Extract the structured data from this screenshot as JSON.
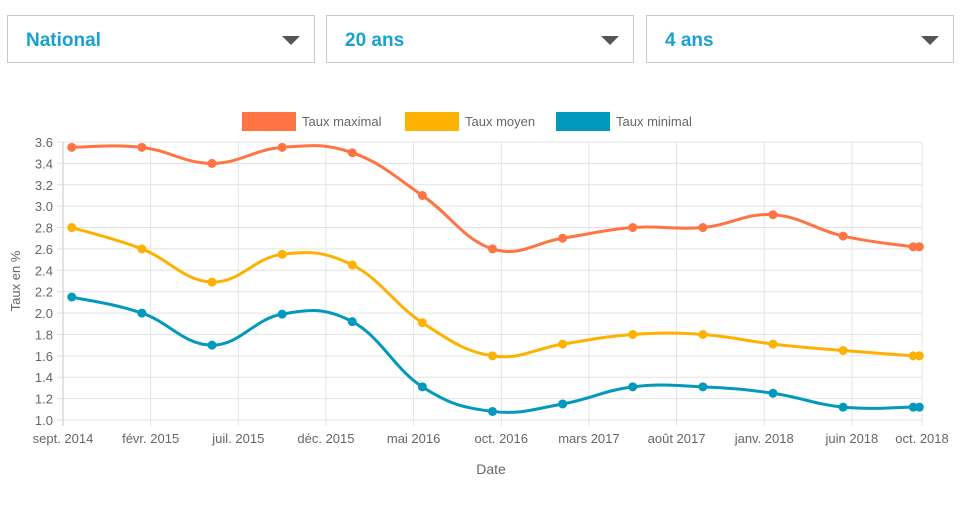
{
  "filters": [
    {
      "value": "National"
    },
    {
      "value": "20 ans"
    },
    {
      "value": "4 ans"
    }
  ],
  "chart_data": {
    "type": "line",
    "title": "",
    "xlabel": "Date",
    "ylabel": "Taux en %",
    "ylim": [
      1.0,
      3.6
    ],
    "yticks": [
      "1.0",
      "1.2",
      "1.4",
      "1.6",
      "1.8",
      "2.0",
      "2.2",
      "2.4",
      "2.6",
      "2.8",
      "3.0",
      "3.2",
      "3.4",
      "3.6"
    ],
    "xtick_labels": [
      "sept. 2014",
      "févr. 2015",
      "juil. 2015",
      "déc. 2015",
      "mai 2016",
      "oct. 2016",
      "mars 2017",
      "août 2017",
      "janv. 2018",
      "juin 2018",
      "oct. 2018"
    ],
    "grid": true,
    "legend_position": "top",
    "x_index": [
      0.1,
      0.9,
      1.7,
      2.5,
      3.3,
      4.1,
      4.9,
      5.7,
      6.5,
      7.3,
      8.1,
      8.9,
      9.7,
      9.77
    ],
    "series": [
      {
        "name": "Taux maximal",
        "color": "#ff7442",
        "values": [
          3.55,
          3.55,
          3.4,
          3.55,
          3.5,
          3.1,
          2.6,
          2.7,
          2.8,
          2.8,
          2.92,
          2.72,
          2.62,
          2.62
        ]
      },
      {
        "name": "Taux moyen",
        "color": "#fdb101",
        "values": [
          2.8,
          2.6,
          2.29,
          2.55,
          2.45,
          1.91,
          1.6,
          1.71,
          1.8,
          1.8,
          1.71,
          1.65,
          1.6,
          1.6
        ]
      },
      {
        "name": "Taux minimal",
        "color": "#0399bd",
        "values": [
          2.15,
          2.0,
          1.7,
          1.99,
          1.92,
          1.31,
          1.08,
          1.15,
          1.31,
          1.31,
          1.25,
          1.12,
          1.12,
          1.12
        ]
      }
    ]
  }
}
